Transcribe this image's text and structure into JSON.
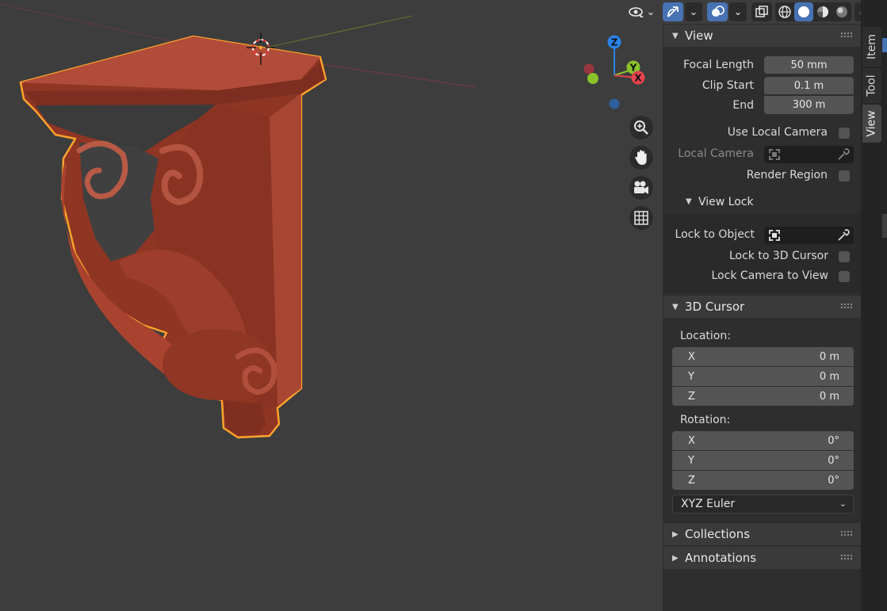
{
  "colors": {
    "viewport_bg": "#3d3d3d",
    "object_fill": "#9a3a28",
    "selection_outline": "#ffa32b",
    "accent": "#4772b3",
    "axis_x": "#e8434f",
    "axis_y": "#8bc32b",
    "axis_z": "#2b83e8"
  },
  "gizmo": {
    "z_label": "Z",
    "y_label": "Y",
    "x_label": "X"
  },
  "icons": {
    "visibility": "eye-arrow-icon",
    "gizmo": "gizmo-arrow-icon",
    "overlays": "overlay-circles-icon",
    "xray": "xray-square-icon",
    "shading_wireframe": "wireframe-sphere-icon",
    "shading_solid": "solid-sphere-icon",
    "shading_material": "material-sphere-icon",
    "shading_rendered": "rendered-sphere-icon",
    "zoom": "zoom-magnifier-icon",
    "pan": "hand-icon",
    "camera": "camera-icon",
    "ortho": "grid-icon"
  },
  "panel": {
    "view": {
      "title": "View",
      "focal_length_label": "Focal Length",
      "focal_length_value": "50 mm",
      "clip_start_label": "Clip Start",
      "clip_start_value": "0.1 m",
      "end_label": "End",
      "end_value": "300 m",
      "use_local_camera_label": "Use Local Camera",
      "use_local_camera_checked": false,
      "local_camera_label": "Local Camera",
      "render_region_label": "Render Region",
      "render_region_checked": false,
      "view_lock": {
        "title": "View Lock",
        "lock_to_object_label": "Lock to Object",
        "lock_to_3d_cursor_label": "Lock to 3D Cursor",
        "lock_camera_to_view_label": "Lock Camera to View"
      }
    },
    "cursor": {
      "title": "3D Cursor",
      "location_label": "Location:",
      "location": [
        {
          "axis": "X",
          "value": "0 m"
        },
        {
          "axis": "Y",
          "value": "0 m"
        },
        {
          "axis": "Z",
          "value": "0 m"
        }
      ],
      "rotation_label": "Rotation:",
      "rotation": [
        {
          "axis": "X",
          "value": "0°"
        },
        {
          "axis": "Y",
          "value": "0°"
        },
        {
          "axis": "Z",
          "value": "0°"
        }
      ],
      "rotation_mode": "XYZ Euler"
    },
    "collections": {
      "title": "Collections"
    },
    "annotations": {
      "title": "Annotations"
    }
  },
  "tabs": [
    {
      "label": "Item",
      "active": false
    },
    {
      "label": "Tool",
      "active": false
    },
    {
      "label": "View",
      "active": true
    }
  ]
}
